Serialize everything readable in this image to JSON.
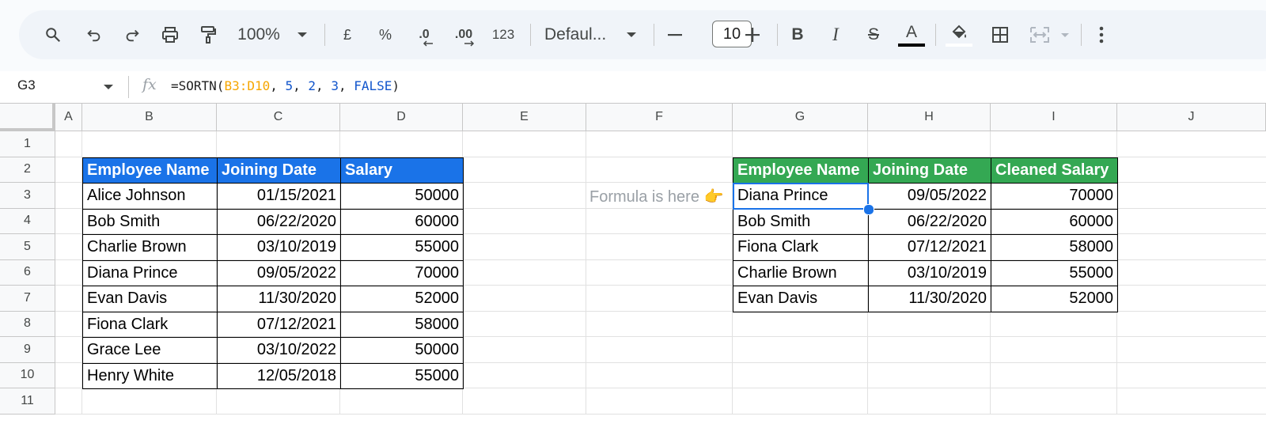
{
  "toolbar": {
    "zoom": "100%",
    "currency_symbol": "£",
    "percent_symbol": "%",
    "decrease_decimal": ".0",
    "increase_decimal": ".00",
    "number_format": "123",
    "font_name": "Defaul...",
    "font_size": "10",
    "text_color": "#000000",
    "fill_color": "#ffffff"
  },
  "formula_bar": {
    "cell_ref": "G3",
    "fx_label": "fx",
    "formula_prefix": "=SORTN(",
    "formula_range": "B3:D10",
    "formula_sep1": ", ",
    "formula_n": "5",
    "formula_sep2": ", ",
    "formula_display_ties": "2",
    "formula_sep3": ", ",
    "formula_sort_col": "3",
    "formula_sep4": ", ",
    "formula_asc": "FALSE",
    "formula_suffix": ")"
  },
  "columns": [
    "A",
    "B",
    "C",
    "D",
    "E",
    "F",
    "G",
    "H",
    "I",
    "J"
  ],
  "rows": [
    "1",
    "2",
    "3",
    "4",
    "5",
    "6",
    "7",
    "8",
    "9",
    "10",
    "11"
  ],
  "source_table": {
    "header_color": "#1a73e8",
    "headers": [
      "Employee Name",
      "Joining Date",
      "Salary"
    ],
    "rows": [
      [
        "Alice Johnson",
        "01/15/2021",
        "50000"
      ],
      [
        "Bob Smith",
        "06/22/2020",
        "60000"
      ],
      [
        "Charlie Brown",
        "03/10/2019",
        "55000"
      ],
      [
        "Diana Prince",
        "09/05/2022",
        "70000"
      ],
      [
        "Evan Davis",
        "11/30/2020",
        "52000"
      ],
      [
        "Fiona Clark",
        "07/12/2021",
        "58000"
      ],
      [
        "Grace Lee",
        "03/10/2022",
        "50000"
      ],
      [
        "Henry White",
        "12/05/2018",
        "55000"
      ]
    ]
  },
  "result_table": {
    "header_color": "#34a853",
    "headers": [
      "Employee Name",
      "Joining Date",
      "Cleaned Salary"
    ],
    "rows": [
      [
        "Diana Prince",
        "09/05/2022",
        "70000"
      ],
      [
        "Bob Smith",
        "06/22/2020",
        "60000"
      ],
      [
        "Fiona Clark",
        "07/12/2021",
        "58000"
      ],
      [
        "Charlie Brown",
        "03/10/2019",
        "55000"
      ],
      [
        "Evan Davis",
        "11/30/2020",
        "52000"
      ]
    ]
  },
  "note": "Formula is here 👉",
  "selection": {
    "cell": "G3",
    "color": "#1a73e8"
  }
}
